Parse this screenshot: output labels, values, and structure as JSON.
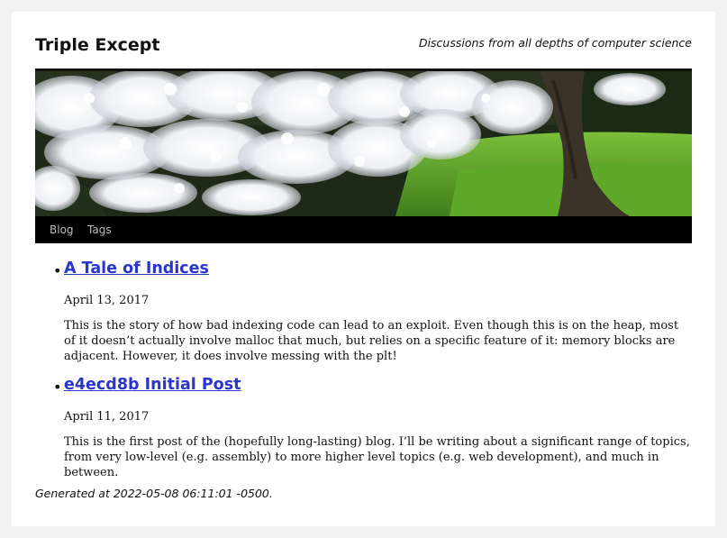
{
  "site": {
    "title": "Triple Except",
    "description": "Discussions from all depths of computer science"
  },
  "banner": {
    "image": "cherry-blossom-tree-photo"
  },
  "nav": {
    "items": [
      {
        "label": "Blog"
      },
      {
        "label": "Tags"
      }
    ]
  },
  "posts": [
    {
      "title": "A Tale of Indices",
      "date": "April 13, 2017",
      "excerpt": "This is the story of how bad indexing code can lead to an exploit. Even though this is on the heap, most of it doesn’t actually involve malloc that much, but relies on a specific feature of it: memory blocks are adjacent. However, it does involve messing with the plt!"
    },
    {
      "title": "e4ecd8b Initial Post",
      "date": "April 11, 2017",
      "excerpt": "This is the first post of the (hopefully long-lasting) blog. I’ll be writing about a significant range of topics, from very low-level (e.g. assembly) to more higher level topics (e.g. web development), and much in between."
    }
  ],
  "footer": {
    "generated": "Generated at 2022-05-08 06:11:01 -0500."
  },
  "colors": {
    "link": "#2a35c9",
    "navbar": "#000000",
    "nav_text": "#bdbdbd",
    "page_bg": "#f1f1f1"
  }
}
